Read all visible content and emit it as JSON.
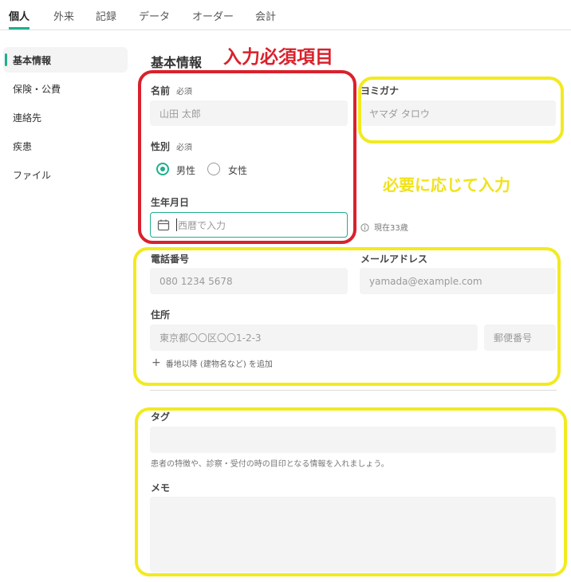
{
  "topnav": {
    "tabs": [
      "個人",
      "外来",
      "記録",
      "データ",
      "オーダー",
      "会計"
    ],
    "active_index": 0
  },
  "sidebar": {
    "items": [
      "基本情報",
      "保険・公費",
      "連絡先",
      "疾患",
      "ファイル"
    ],
    "active_index": 0
  },
  "section": {
    "title": "基本情報"
  },
  "annotations": {
    "required": "入力必須項目",
    "optional": "必要に応じて入力"
  },
  "form": {
    "name": {
      "label": "名前",
      "required": "必須",
      "placeholder": "山田 太郎"
    },
    "kana": {
      "label": "ヨミガナ",
      "placeholder": "ヤマダ タロウ"
    },
    "sex": {
      "label": "性別",
      "required": "必須",
      "options": [
        "男性",
        "女性"
      ],
      "selected": "男性"
    },
    "birthdate": {
      "label": "生年月日",
      "placeholder": "西暦で入力",
      "age_note": "現在33歳"
    },
    "phone": {
      "label": "電話番号",
      "placeholder": "080 1234 5678"
    },
    "email": {
      "label": "メールアドレス",
      "placeholder": "yamada@example.com"
    },
    "address": {
      "label": "住所",
      "placeholder": "東京都〇〇区〇〇1-2-3",
      "postal_placeholder": "郵便番号",
      "add_line": "番地以降 (建物名など) を追加"
    },
    "tags": {
      "label": "タグ",
      "hint": "患者の特徴や、診察・受付の時の目印となる情報を入れましょう。"
    },
    "memo": {
      "label": "メモ"
    }
  },
  "colors": {
    "accent": "#1fae8f",
    "annot_red": "#d9212c",
    "annot_yellow": "#f2ea20"
  },
  "icons": {
    "calendar": "calendar-icon",
    "info": "info-icon",
    "plus": "plus-icon"
  }
}
